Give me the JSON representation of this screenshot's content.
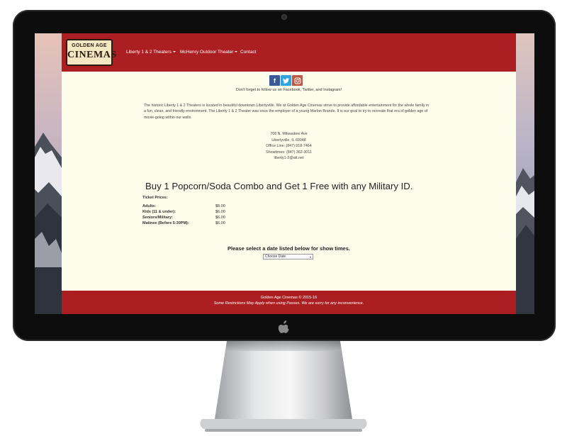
{
  "nav": {
    "logo_top": "GOLDEN AGE",
    "logo_bottom": "CINEMAS",
    "items": [
      {
        "label": "Liberty 1 & 2 Theaters"
      },
      {
        "label": "McHenry Outdoor Theater"
      },
      {
        "label": "Contact"
      }
    ]
  },
  "social": {
    "follow_text": "Don't forget to follow us on Facebook, Twitter, and Instagram!",
    "icons": [
      "facebook-icon",
      "twitter-icon",
      "instagram-icon"
    ]
  },
  "about": {
    "text": "The historic Liberty 1 & 2 Theaters is located in beautiful downtown Libertyville. We at Golden Age Cinemas strive to provide affordable entertainment for the whole family in a fun, clean, and friendly environment. The Liberty 1 & 2 Theater was once the employer of a young Marlon Brando. It is our goal to try to recreate that era of golden age of movie-going within our walls."
  },
  "address": {
    "street": "708 N. Milwaukee Ave",
    "city": "Libertyville, IL 60048",
    "office": "Office Line: (847) 918-7464",
    "showtimes": "Showtimes: (847) 362-3011",
    "email": "liberty1-2@att.net"
  },
  "promo": "Buy 1 Popcorn/Soda Combo and Get 1 Free with any Military ID.",
  "tickets": {
    "title": "Ticket Prices:",
    "rows": [
      {
        "label": "Adults:",
        "price": "$8.00"
      },
      {
        "label": "Kids (11 & under):",
        "price": "$6.00"
      },
      {
        "label": "Seniors/Military:",
        "price": "$6.00"
      },
      {
        "label": "Matinee (Before 5:30PM):",
        "price": "$6.00"
      }
    ]
  },
  "showtimes": {
    "prompt": "Please select a date listed below for show times.",
    "select_value": "Choose Date"
  },
  "footer": {
    "copyright": "Golden Age Cinemas © 2015-16",
    "note": "Some Restrictions May Apply when using Passes. We are sorry for any inconvenience."
  },
  "colors": {
    "brand_red": "#ab1f22",
    "page_bg": "#fdfdec"
  }
}
